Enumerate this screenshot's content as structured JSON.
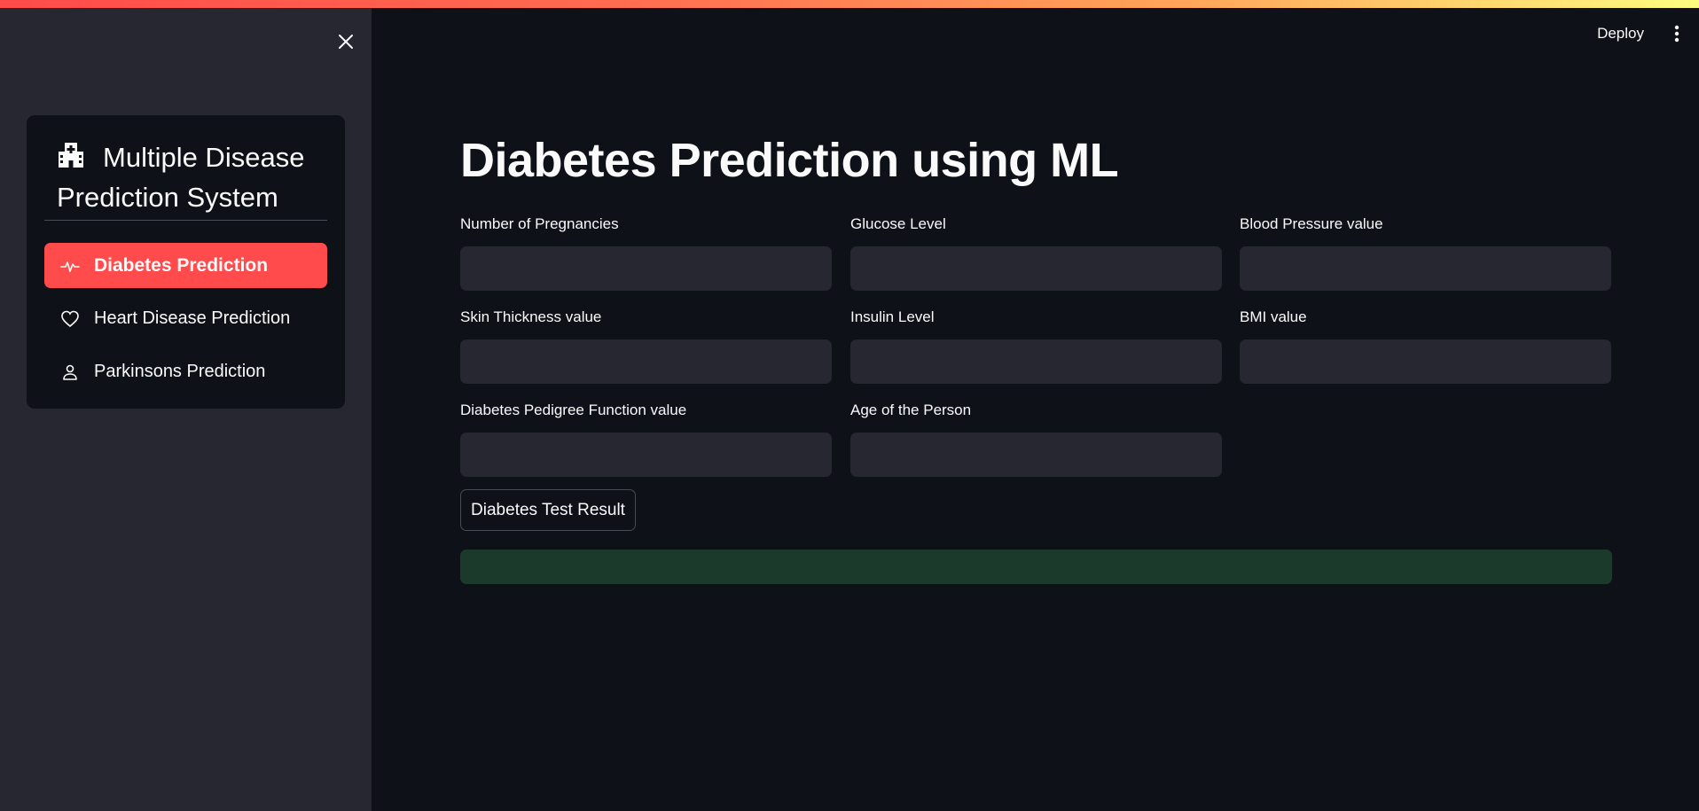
{
  "sidebar": {
    "title": "Multiple Disease Prediction System",
    "items": [
      {
        "label": "Diabetes Prediction",
        "icon": "activity-icon",
        "active": true
      },
      {
        "label": "Heart Disease Prediction",
        "icon": "heart-icon",
        "active": false
      },
      {
        "label": "Parkinsons Prediction",
        "icon": "person-icon",
        "active": false
      }
    ]
  },
  "header": {
    "deploy_label": "Deploy"
  },
  "main": {
    "title": "Diabetes Prediction using ML",
    "fields": [
      {
        "label": "Number of Pregnancies",
        "value": ""
      },
      {
        "label": "Glucose Level",
        "value": ""
      },
      {
        "label": "Blood Pressure value",
        "value": ""
      },
      {
        "label": "Skin Thickness value",
        "value": ""
      },
      {
        "label": "Insulin Level",
        "value": ""
      },
      {
        "label": "BMI value",
        "value": ""
      },
      {
        "label": "Diabetes Pedigree Function value",
        "value": ""
      },
      {
        "label": "Age of the Person",
        "value": ""
      }
    ],
    "submit_label": "Diabetes Test Result",
    "result_text": ""
  },
  "colors": {
    "accent": "#ff4b4b",
    "sidebar_bg": "#262730",
    "main_bg": "#0e1117",
    "input_bg": "#262730",
    "success_bg": "#1c3a2b"
  }
}
